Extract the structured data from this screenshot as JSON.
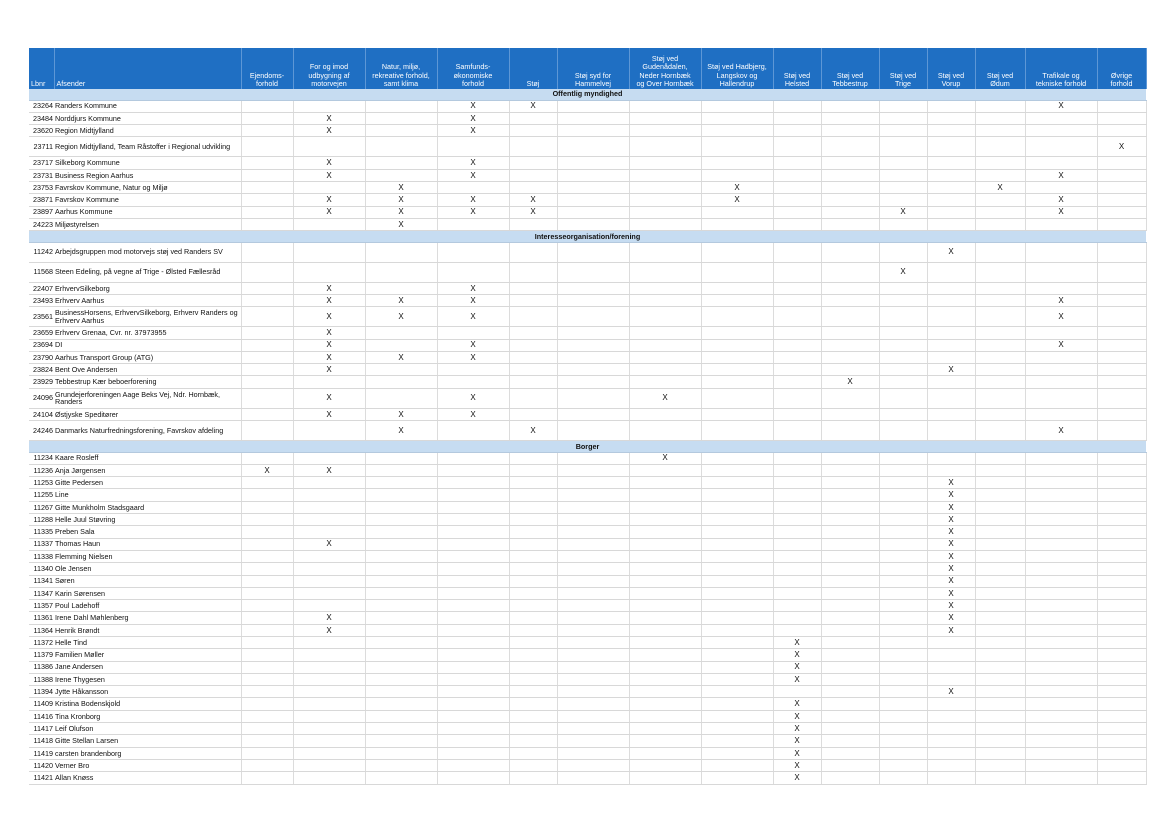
{
  "columns": [
    "Lbnr",
    "Afsender",
    "Ejendoms-\nforhold",
    "For og imod\nudbygning af\nmotorvejen",
    "Natur, miljø,\nrekreative forhold,\nsamt klima",
    "Samfunds-\nøkonomiske\nforhold",
    "Støj",
    "Støj syd for\nHammelvej",
    "Støj ved\nGudenådalen,\nNeder Hornbæk\nog Over Hornbæk",
    "Støj ved Hadbjerg,\nLangskov og\nHallendrup",
    "Støj ved\nHelsted",
    "Støj ved\nTebbestrup",
    "Støj ved\nTrige",
    "Støj ved\nVorup",
    "Støj ved\nØdum",
    "Trafikale og\ntekniske forhold",
    "Øvrige\nforhold"
  ],
  "mark": "X",
  "sections": [
    {
      "title": "Offentlig myndighed",
      "rows": [
        {
          "lbnr": "23264",
          "afsender": "Randers Kommune",
          "marks": [
            5,
            6,
            15
          ]
        },
        {
          "lbnr": "23484",
          "afsender": "Norddjurs Kommune",
          "marks": [
            3,
            5
          ]
        },
        {
          "lbnr": "23620",
          "afsender": "Region Midtjylland",
          "marks": [
            3,
            5
          ]
        },
        {
          "lbnr": "23711",
          "afsender": "Region Midtjylland, Team Råstoffer i Regional udvikling",
          "marks": [
            16
          ],
          "tall": true
        },
        {
          "lbnr": "23717",
          "afsender": "Silkeborg Kommune",
          "marks": [
            3,
            5
          ]
        },
        {
          "lbnr": "23731",
          "afsender": "Business Region Aarhus",
          "marks": [
            3,
            5,
            15
          ]
        },
        {
          "lbnr": "23753",
          "afsender": "Favrskov Kommune, Natur og Miljø",
          "marks": [
            4,
            9,
            14
          ]
        },
        {
          "lbnr": "23871",
          "afsender": "Favrskov Kommune",
          "marks": [
            3,
            4,
            5,
            6,
            9,
            15
          ]
        },
        {
          "lbnr": "23897",
          "afsender": "Aarhus Kommune",
          "marks": [
            3,
            4,
            5,
            6,
            12,
            15
          ]
        },
        {
          "lbnr": "24223",
          "afsender": "Miljøstyrelsen",
          "marks": [
            4
          ]
        }
      ]
    },
    {
      "title": "Interesseorganisation/forening",
      "rows": [
        {
          "lbnr": "11242",
          "afsender": "Arbejdsgruppen mod motorvejs støj ved Randers SV",
          "marks": [
            13
          ],
          "tall": true
        },
        {
          "lbnr": "11568",
          "afsender": "Steen Edeling, på vegne af Trige - Ølsted Fællesråd",
          "marks": [
            12
          ],
          "tall": true
        },
        {
          "lbnr": "22407",
          "afsender": "ErhvervSilkeborg",
          "marks": [
            3,
            5
          ]
        },
        {
          "lbnr": "23493",
          "afsender": "Erhverv Aarhus",
          "marks": [
            3,
            4,
            5,
            15
          ]
        },
        {
          "lbnr": "23561",
          "afsender": "BusinessHorsens, ErhvervSilkeborg, Erhverv Randers og Erhverv Aarhus",
          "marks": [
            3,
            4,
            5,
            15
          ],
          "tall": true
        },
        {
          "lbnr": "23659",
          "afsender": "Erhverv Grenaa, Cvr. nr. 37973955",
          "marks": [
            3
          ]
        },
        {
          "lbnr": "23694",
          "afsender": "DI",
          "marks": [
            3,
            5,
            15
          ]
        },
        {
          "lbnr": "23790",
          "afsender": "Aarhus Transport Group (ATG)",
          "marks": [
            3,
            4,
            5
          ]
        },
        {
          "lbnr": "23824",
          "afsender": "Bent Ove Andersen",
          "marks": [
            3,
            13
          ]
        },
        {
          "lbnr": "23929",
          "afsender": "Tebbestrup Kær beboerforening",
          "marks": [
            11
          ]
        },
        {
          "lbnr": "24096",
          "afsender": "Grundejerforeningen Aage Beks Vej, Ndr. Hornbæk, Randers",
          "marks": [
            3,
            5,
            8
          ],
          "tall": true
        },
        {
          "lbnr": "24104",
          "afsender": "Østjyske Speditører",
          "marks": [
            3,
            4,
            5
          ]
        },
        {
          "lbnr": "24246",
          "afsender": "Danmarks Naturfredningsforening, Favrskov afdeling",
          "marks": [
            4,
            6,
            15
          ],
          "tall": true
        }
      ]
    },
    {
      "title": "Borger",
      "rows": [
        {
          "lbnr": "11234",
          "afsender": "Kaare Rosleff",
          "marks": [
            8
          ]
        },
        {
          "lbnr": "11236",
          "afsender": "Anja Jørgensen",
          "marks": [
            2,
            3
          ]
        },
        {
          "lbnr": "11253",
          "afsender": "Gitte Pedersen",
          "marks": [
            13
          ]
        },
        {
          "lbnr": "11255",
          "afsender": "Line",
          "marks": [
            13
          ]
        },
        {
          "lbnr": "11267",
          "afsender": "Gitte Munkholm Stadsgaard",
          "marks": [
            13
          ]
        },
        {
          "lbnr": "11288",
          "afsender": "Helle Juul Støvring",
          "marks": [
            13
          ]
        },
        {
          "lbnr": "11335",
          "afsender": "Preben Sala",
          "marks": [
            13
          ]
        },
        {
          "lbnr": "11337",
          "afsender": "Thomas Haun",
          "marks": [
            3,
            13
          ]
        },
        {
          "lbnr": "11338",
          "afsender": "Flemming Nielsen",
          "marks": [
            13
          ]
        },
        {
          "lbnr": "11340",
          "afsender": "Ole Jensen",
          "marks": [
            13
          ]
        },
        {
          "lbnr": "11341",
          "afsender": "Søren",
          "marks": [
            13
          ]
        },
        {
          "lbnr": "11347",
          "afsender": "Karin Sørensen",
          "marks": [
            13
          ]
        },
        {
          "lbnr": "11357",
          "afsender": "Poul Ladehoff",
          "marks": [
            13
          ]
        },
        {
          "lbnr": "11361",
          "afsender": "Irene Dahl Møhlenberg",
          "marks": [
            3,
            13
          ]
        },
        {
          "lbnr": "11364",
          "afsender": "Henrik Brøndt",
          "marks": [
            3,
            13
          ]
        },
        {
          "lbnr": "11372",
          "afsender": "Helle Tind",
          "marks": [
            10
          ]
        },
        {
          "lbnr": "11379",
          "afsender": "Familien Møller",
          "marks": [
            10
          ]
        },
        {
          "lbnr": "11386",
          "afsender": "Jane Andersen",
          "marks": [
            10
          ]
        },
        {
          "lbnr": "11388",
          "afsender": "Irene Thygesen",
          "marks": [
            10
          ]
        },
        {
          "lbnr": "11394",
          "afsender": "Jytte Håkansson",
          "marks": [
            13
          ]
        },
        {
          "lbnr": "11409",
          "afsender": "Kristina Bodenskjold",
          "marks": [
            10
          ]
        },
        {
          "lbnr": "11416",
          "afsender": "Tina Kronborg",
          "marks": [
            10
          ]
        },
        {
          "lbnr": "11417",
          "afsender": "Leif Olufson",
          "marks": [
            10
          ]
        },
        {
          "lbnr": "11418",
          "afsender": "Gitte Stellan Larsen",
          "marks": [
            10
          ]
        },
        {
          "lbnr": "11419",
          "afsender": "carsten brandenborg",
          "marks": [
            10
          ]
        },
        {
          "lbnr": "11420",
          "afsender": "Verner Bro",
          "marks": [
            10
          ]
        },
        {
          "lbnr": "11421",
          "afsender": "Allan Knøss",
          "marks": [
            10
          ]
        }
      ]
    }
  ]
}
